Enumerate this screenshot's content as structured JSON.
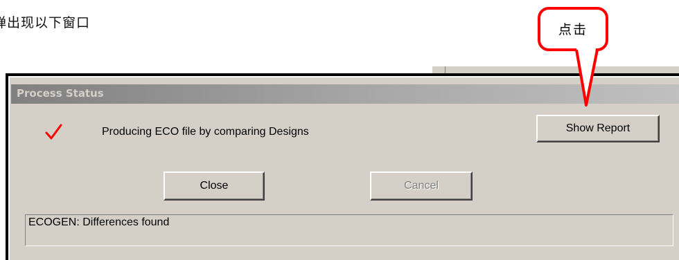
{
  "document": {
    "caption": "弹出现以下窗口"
  },
  "callout": {
    "text": "点击",
    "color": "#ff0000"
  },
  "dialog": {
    "title": "Process Status",
    "status_message": "Producing ECO file by comparing Designs",
    "status_icon": "checkmark-icon",
    "status_icon_color": "#ff0000",
    "buttons": {
      "show_report": "Show Report",
      "close": "Close",
      "cancel": "Cancel"
    },
    "log_text": "ECOGEN: Differences found"
  }
}
